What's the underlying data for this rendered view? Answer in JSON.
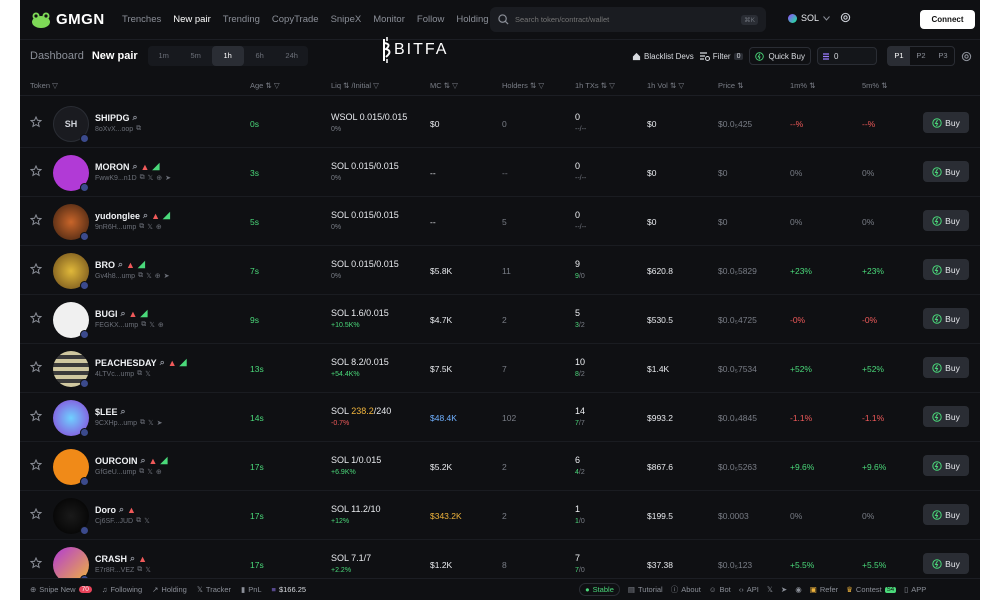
{
  "brand": {
    "name": "GMGN",
    "overlay": "BITFA"
  },
  "nav": [
    "Trenches",
    "New pair",
    "Trending",
    "CopyTrade",
    "SnipeX",
    "Monitor",
    "Follow",
    "Holding"
  ],
  "search": {
    "placeholder": "Search token/contract/wallet",
    "shortcut": "⌘K"
  },
  "chain": "SOL",
  "connect_label": "Connect",
  "subbar": {
    "dashboard": "Dashboard",
    "new_pair": "New pair",
    "timeframes": [
      "1m",
      "5m",
      "1h",
      "6h",
      "24h"
    ],
    "selected_timeframe": "1h",
    "blacklist": "Blacklist Devs",
    "filter": "Filter",
    "filter_count": "0",
    "quick_buy": "Quick Buy",
    "quick_buy_value": "0",
    "presets": [
      "P1",
      "P2",
      "P3"
    ]
  },
  "columns": {
    "token": "Token",
    "age": "Age",
    "liq": "Liq ⇅ /Initial",
    "mc": "MC",
    "holders": "Holders",
    "txs": "1h TXs",
    "vol": "1h Vol",
    "price": "Price",
    "m1": "1m%",
    "m5": "5m%"
  },
  "rows": [
    {
      "name": "SHIPDG",
      "addr": "8oXvX...oop",
      "avatar_text": "SH",
      "age": "0s",
      "liq": "WSOL 0.015/0.015",
      "liq_pct": "0%",
      "mc": "$0",
      "holders": "0",
      "txs": "0",
      "tx_sub": "--/--",
      "vol": "$0",
      "price": "$0.0₅425",
      "m1": "--%",
      "m5": "--%",
      "buy": "Buy"
    },
    {
      "name": "MORON",
      "addr": "FwwK9...n1D",
      "avatar_text": "",
      "age": "3s",
      "liq": "SOL 0.015/0.015",
      "liq_pct": "0%",
      "mc": "--",
      "holders": "--",
      "txs": "0",
      "tx_sub": "--/--",
      "vol": "$0",
      "price": "$0",
      "m1": "0%",
      "m5": "0%",
      "buy": "Buy"
    },
    {
      "name": "yudonglee",
      "addr": "9nR6H...ump",
      "avatar_text": "",
      "age": "5s",
      "liq": "SOL 0.015/0.015",
      "liq_pct": "0%",
      "mc": "--",
      "holders": "5",
      "txs": "0",
      "tx_sub": "--/--",
      "vol": "$0",
      "price": "$0",
      "m1": "0%",
      "m5": "0%",
      "buy": "Buy"
    },
    {
      "name": "BRO",
      "addr": "Gv4h8...ump",
      "avatar_text": "",
      "age": "7s",
      "liq": "SOL 0.015/0.015",
      "liq_pct": "0%",
      "mc": "$5.8K",
      "holders": "11",
      "txs": "9",
      "tx_sub_a": "9",
      "tx_sub_b": "0",
      "vol": "$620.8",
      "price": "$0.0₅5829",
      "m1": "+23%",
      "m5": "+23%",
      "buy": "Buy"
    },
    {
      "name": "BUGI",
      "addr": "FEGKX...ump",
      "avatar_text": "",
      "age": "9s",
      "liq": "SOL 1.6/0.015",
      "liq_pct": "+10.5K%",
      "mc": "$4.7K",
      "holders": "2",
      "txs": "5",
      "tx_sub_a": "3",
      "tx_sub_b": "2",
      "vol": "$530.5",
      "price": "$0.0₅4725",
      "m1": "-0%",
      "m5": "-0%",
      "buy": "Buy"
    },
    {
      "name": "PEACHESDAY",
      "addr": "4LTVc...ump",
      "avatar_text": "",
      "age": "13s",
      "liq": "SOL 8.2/0.015",
      "liq_pct": "+54.4K%",
      "mc": "$7.5K",
      "holders": "7",
      "txs": "10",
      "tx_sub_a": "8",
      "tx_sub_b": "2",
      "vol": "$1.4K",
      "price": "$0.0₅7534",
      "m1": "+52%",
      "m5": "+52%",
      "buy": "Buy"
    },
    {
      "name": "$LEE",
      "addr": "9CXHp...ump",
      "avatar_text": "",
      "age": "14s",
      "liq_a": "SOL ",
      "liq_hl": "238.2",
      "liq_b": "/240",
      "liq_pct": "-0.7%",
      "mc": "$48.4K",
      "holders": "102",
      "txs": "14",
      "tx_sub_a": "7",
      "tx_sub_b": "7",
      "vol": "$993.2",
      "price": "$0.0₄4845",
      "m1": "-1.1%",
      "m5": "-1.1%",
      "buy": "Buy"
    },
    {
      "name": "OURCOIN",
      "addr": "GfGeU...ump",
      "avatar_text": "",
      "age": "17s",
      "liq": "SOL 1/0.015",
      "liq_pct": "+6.9K%",
      "mc": "$5.2K",
      "holders": "2",
      "txs": "6",
      "tx_sub_a": "4",
      "tx_sub_b": "2",
      "vol": "$867.6",
      "price": "$0.0₅5263",
      "m1": "+9.6%",
      "m5": "+9.6%",
      "buy": "Buy"
    },
    {
      "name": "Doro",
      "addr": "Cj6SF...JUD",
      "avatar_text": "",
      "age": "17s",
      "liq": "SOL 11.2/10",
      "liq_pct": "+12%",
      "mc": "$343.2K",
      "holders": "2",
      "txs": "1",
      "tx_sub_a": "1",
      "tx_sub_b": "0",
      "vol": "$199.5",
      "price": "$0.0003",
      "m1": "0%",
      "m5": "0%",
      "buy": "Buy"
    },
    {
      "name": "CRASH",
      "addr": "E7r8R...VEZ",
      "avatar_text": "",
      "age": "17s",
      "liq": "SOL 7.1/7",
      "liq_pct": "+2.2%",
      "mc": "$1.2K",
      "holders": "8",
      "txs": "7",
      "tx_sub_a": "7",
      "tx_sub_b": "0",
      "vol": "$37.38",
      "price": "$0.0₅123",
      "m1": "+5.5%",
      "m5": "+5.5%",
      "buy": "Buy"
    }
  ],
  "footer": {
    "snipe_new": "Snipe New",
    "snipe_count": "70",
    "following": "Following",
    "holding": "Holding",
    "tracker": "Tracker",
    "pnl": "PnL",
    "balance": "$166.25",
    "stable": "Stable",
    "tutorial": "Tutorial",
    "about": "About",
    "bot": "Bot",
    "api": "API",
    "refer": "Refer",
    "contest": "Contest",
    "contest_badge": "S4",
    "app": "APP"
  },
  "colors": {
    "accent_green": "#4ad97a",
    "negative_red": "#f05a5a",
    "background": "#0f1013"
  }
}
